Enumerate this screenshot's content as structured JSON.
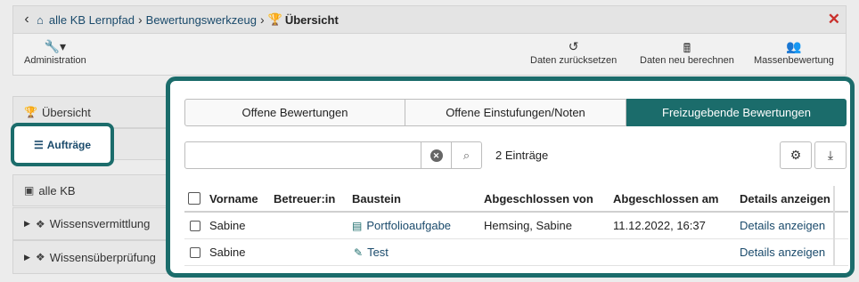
{
  "topbar": {
    "back_icon": "chevron-left-icon",
    "home_icon": "home-icon",
    "crumb1": "alle KB Lernpfad",
    "crumb2": "Bewertungswerkzeug",
    "crumb3": "Übersicht",
    "close_icon": "close-icon"
  },
  "toolbar": {
    "administration": "Administration",
    "reset": "Daten zurücksetzen",
    "recalc": "Daten neu berechnen",
    "mass": "Massenbewertung"
  },
  "sidebar": {
    "items": [
      {
        "label": "Übersicht",
        "icon": "trophy-icon"
      },
      {
        "label": "Aufträge",
        "icon": "list-icon"
      },
      {
        "label": "alle KB",
        "icon": "cube-icon"
      },
      {
        "label": "Wissensvermittlung",
        "icon": "cubes-icon"
      },
      {
        "label": "Wissensüberprüfung",
        "icon": "cubes-icon"
      }
    ]
  },
  "tabs": [
    {
      "label": "Offene Bewertungen",
      "active": false
    },
    {
      "label": "Offene Einstufungen/Noten",
      "active": false
    },
    {
      "label": "Freizugebende Bewertungen",
      "active": true
    }
  ],
  "search": {
    "value": "",
    "placeholder": ""
  },
  "count": "2 Einträge",
  "table": {
    "headers": [
      "Vorname",
      "Betreuer:in",
      "Baustein",
      "Abgeschlossen von",
      "Abgeschlossen am",
      "Details anzeigen"
    ],
    "rows": [
      {
        "vorname": "Sabine",
        "betreuer": "",
        "baustein": "Portfolioaufgabe",
        "baustein_icon": "briefcase-icon",
        "von": "Hemsing, Sabine",
        "am": "11.12.2022, 16:37",
        "details": "Details anzeigen"
      },
      {
        "vorname": "Sabine",
        "betreuer": "",
        "baustein": "Test",
        "baustein_icon": "edit-square-icon",
        "von": "",
        "am": "",
        "details": "Details anzeigen"
      }
    ]
  },
  "colors": {
    "accent": "#1b6c6b",
    "link": "#1a4a6b",
    "close": "#c9302c"
  }
}
